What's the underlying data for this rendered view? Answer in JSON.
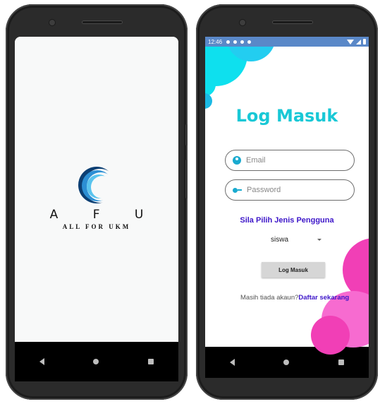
{
  "splash": {
    "logo_letters": "A F U",
    "logo_tagline": "ALL FOR UKM"
  },
  "statusbar": {
    "time": "12:46"
  },
  "login": {
    "title": "Log Masuk",
    "email_placeholder": "Email",
    "password_placeholder": "Password",
    "user_type_prompt": "Sila Pilih Jenis Pengguna",
    "user_type_selected": "siswa",
    "login_button": "Log Masuk",
    "no_account_text": "Masih tiada akaun?",
    "signup_link": "Daftar sekarang"
  },
  "colors": {
    "accent_cyan": "#19c8d6",
    "accent_purple": "#3d16c9",
    "blob_pink": "#f13fb6"
  }
}
